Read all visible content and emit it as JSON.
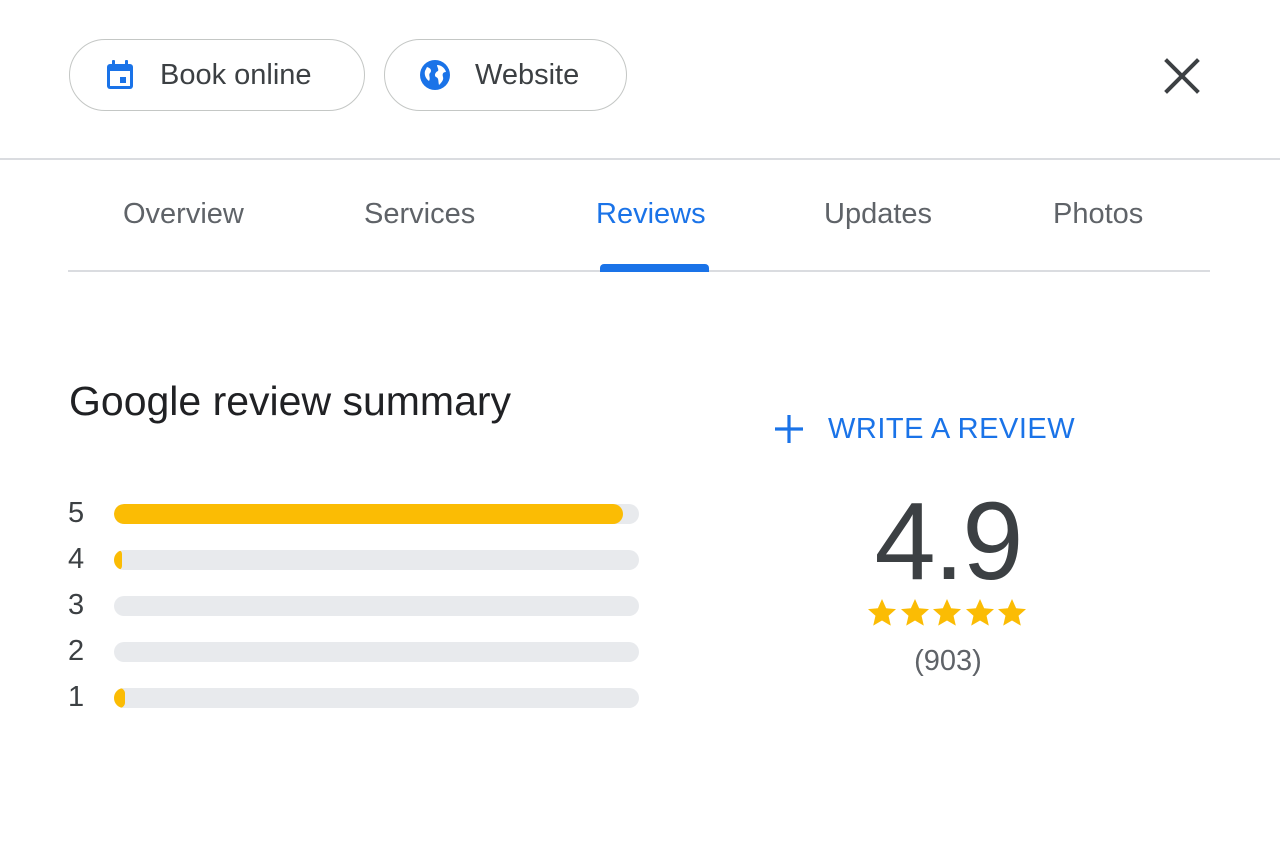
{
  "actions": {
    "book_online_label": "Book online",
    "website_label": "Website"
  },
  "tabs": [
    {
      "label": "Overview"
    },
    {
      "label": "Services"
    },
    {
      "label": "Reviews",
      "active": true
    },
    {
      "label": "Updates"
    },
    {
      "label": "Photos"
    }
  ],
  "summary": {
    "title": "Google review summary",
    "write_review_label": "WRITE A REVIEW",
    "average_rating": "4.9",
    "review_count": "(903)",
    "stars_filled": 5,
    "distribution": [
      {
        "stars": "5",
        "fraction": 0.97
      },
      {
        "stars": "4",
        "fraction": 0.01
      },
      {
        "stars": "3",
        "fraction": 0.0
      },
      {
        "stars": "2",
        "fraction": 0.0
      },
      {
        "stars": "1",
        "fraction": 0.02
      }
    ]
  },
  "colors": {
    "accent": "#1a73e8",
    "star": "#fbbc04",
    "track": "#e8eaed"
  },
  "icons": {
    "book": "calendar-icon",
    "website": "globe-icon",
    "close": "close-icon",
    "write": "plus-icon",
    "star": "star-icon"
  }
}
